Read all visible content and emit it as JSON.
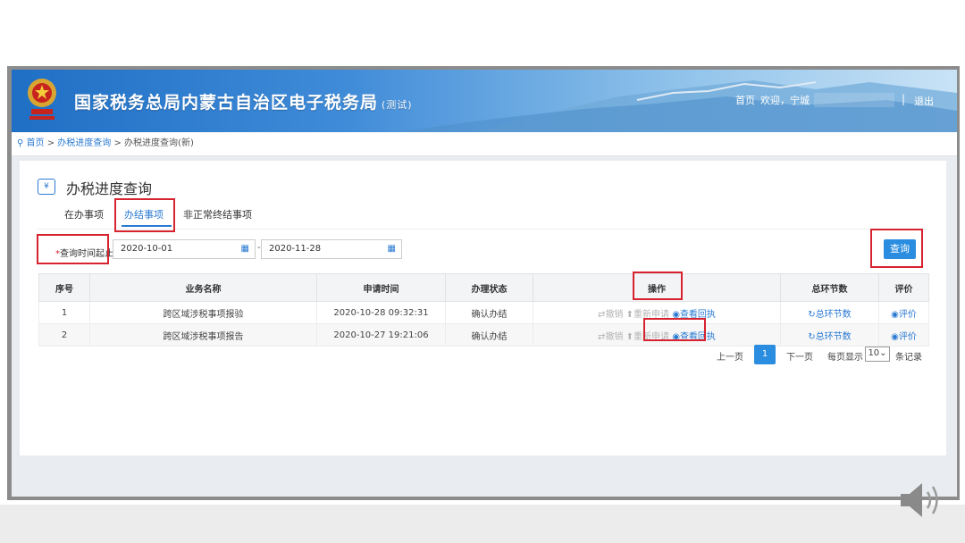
{
  "header": {
    "title": "国家税务总局内蒙古自治区电子税务局",
    "title_suffix": "(测试)",
    "home_link": "首页",
    "welcome": "欢迎，宁城",
    "separator": "|",
    "logout": "退出"
  },
  "breadcrumb": {
    "home": "首页",
    "sep1": ">",
    "level1": "办税进度查询",
    "sep2": ">",
    "current": "办税进度查询(新)"
  },
  "page": {
    "title": "办税进度查询",
    "tabs": [
      {
        "label": "在办事项",
        "active": false
      },
      {
        "label": "办结事项",
        "active": true
      },
      {
        "label": "非正常终结事项",
        "active": false
      }
    ]
  },
  "filter": {
    "required_mark": "*",
    "range_label": "查询时间起止",
    "start_date": "2020-10-01",
    "range_sep": "-",
    "end_date": "2020-11-28",
    "query_button": "查询"
  },
  "table": {
    "columns": [
      "序号",
      "业务名称",
      "申请时间",
      "办理状态",
      "操作",
      "总环节数",
      "评价"
    ],
    "rows": [
      {
        "index": "1",
        "name": "跨区域涉税事项报验",
        "time": "2020-10-28 09:32:31",
        "status": "确认办结",
        "op_revoke": "撤销",
        "op_reapply": "重新申请",
        "op_view": "查看回执",
        "steps": "总环节数",
        "rate": "评价"
      },
      {
        "index": "2",
        "name": "跨区域涉税事项报告",
        "time": "2020-10-27 19:21:06",
        "status": "确认办结",
        "op_revoke": "撤销",
        "op_reapply": "重新申请",
        "op_view": "查看回执",
        "steps": "总环节数",
        "rate": "评价"
      }
    ]
  },
  "pager": {
    "prev": "上一页",
    "current_page": "1",
    "next": "下一页",
    "page_size_label": "每页显示",
    "page_size": "10",
    "records_label": "条记录"
  },
  "colors": {
    "accent": "#2a7ad2",
    "highlight_box": "#d6232f",
    "banner": "#1f6fc5"
  },
  "icons": [
    "national-emblem-icon",
    "map-pin-icon",
    "calendar-icon",
    "swap-icon",
    "upload-icon",
    "eye-icon",
    "refresh-icon",
    "speaker-icon"
  ]
}
